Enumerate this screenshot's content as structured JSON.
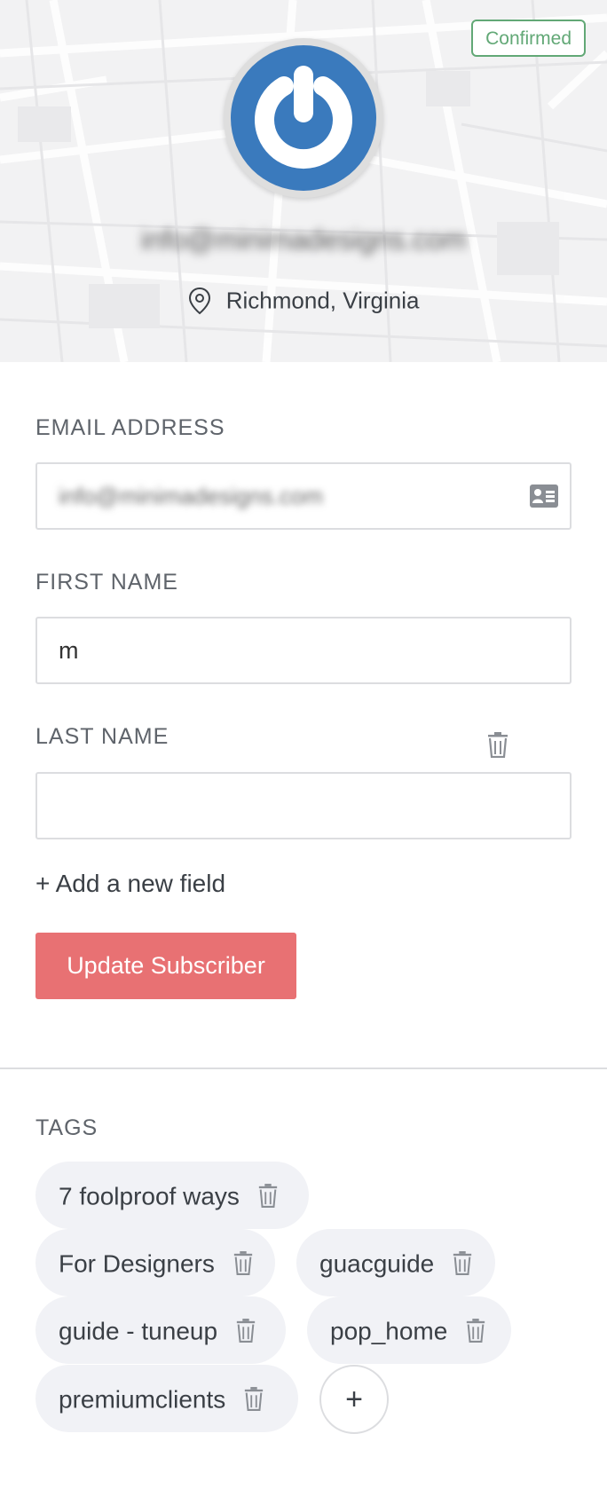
{
  "profile": {
    "status_badge": "Confirmed",
    "email": "info@minimadesigns.com",
    "location": "Richmond, Virginia"
  },
  "form": {
    "email_label": "EMAIL ADDRESS",
    "email_value": "info@minimadesigns.com",
    "first_name_label": "FIRST NAME",
    "first_name_value": "m",
    "last_name_label": "LAST NAME",
    "last_name_value": "",
    "add_field": "+ Add a new field",
    "submit_label": "Update Subscriber"
  },
  "tags": {
    "heading": "TAGS",
    "items": [
      {
        "label": "7 foolproof ways"
      },
      {
        "label": "For Designers"
      },
      {
        "label": "guacguide"
      },
      {
        "label": "guide - tuneup"
      },
      {
        "label": "pop_home"
      },
      {
        "label": "premiumclients"
      }
    ],
    "add_symbol": "+"
  },
  "icons": [
    "map-background",
    "logo-power-icon",
    "location-pin-icon",
    "contact-card-icon",
    "trash-icon",
    "plus-icon"
  ],
  "colors": {
    "accent_button": "#e87173",
    "confirmed_green": "#62a876",
    "avatar_blue": "#3a7abd",
    "tag_background": "#f1f2f6"
  }
}
